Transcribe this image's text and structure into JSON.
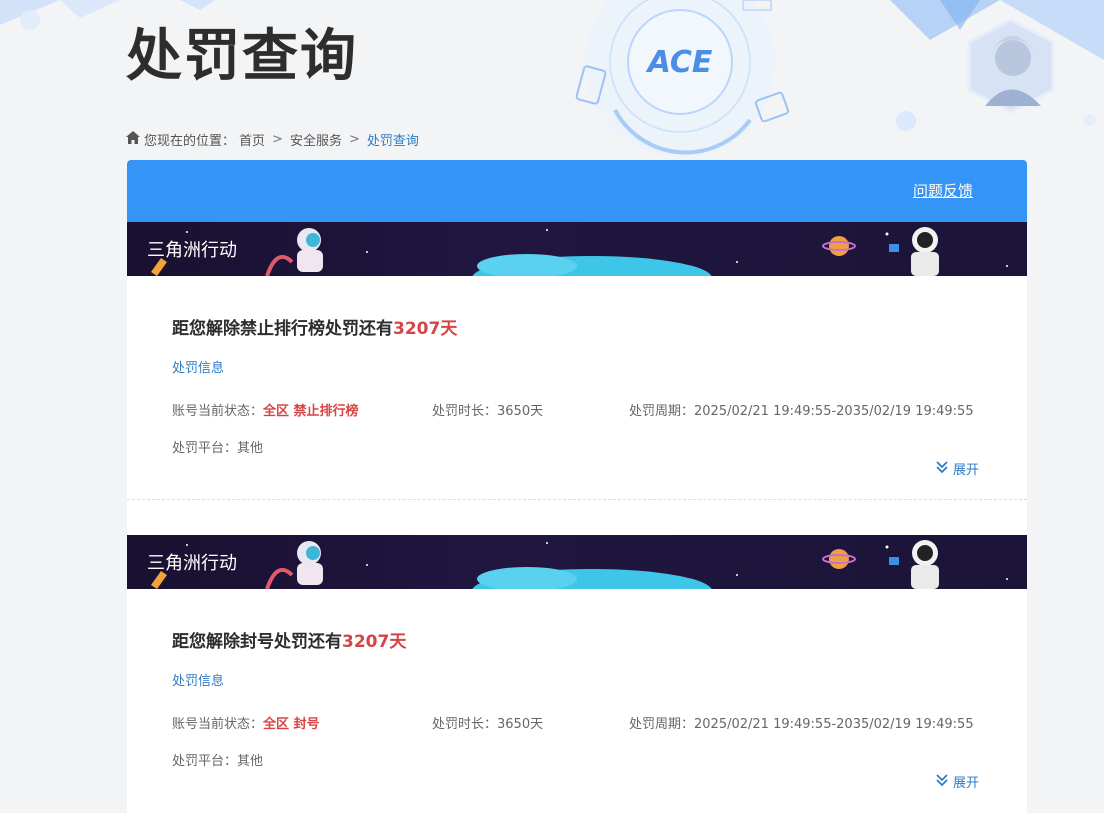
{
  "page": {
    "title": "处罚查询"
  },
  "breadcrumb": {
    "prefix": "您现在的位置：",
    "items": [
      "首页",
      "安全服务",
      "处罚查询"
    ],
    "separator": ">"
  },
  "header": {
    "feedback_label": "问题反馈",
    "bar_color": "#3595f6",
    "logo_text": "ACE"
  },
  "records": [
    {
      "game_name": "三角洲行动",
      "headline_prefix": "距您解除禁止排行榜处罚还有",
      "headline_days": "3207天",
      "section_label": "处罚信息",
      "status_label": "账号当前状态：",
      "status_value": "全区 禁止排行榜",
      "duration_label": "处罚时长：",
      "duration_value": "3650天",
      "period_label": "处罚周期：",
      "period_value": "2025/02/21 19:49:55-2035/02/19 19:49:55",
      "platform_label": "处罚平台：",
      "platform_value": "其他",
      "expand_label": "展开"
    },
    {
      "game_name": "三角洲行动",
      "headline_prefix": "距您解除封号处罚还有",
      "headline_days": "3207天",
      "section_label": "处罚信息",
      "status_label": "账号当前状态：",
      "status_value": "全区 封号",
      "duration_label": "处罚时长：",
      "duration_value": "3650天",
      "period_label": "处罚周期：",
      "period_value": "2025/02/21 19:49:55-2035/02/19 19:49:55",
      "platform_label": "处罚平台：",
      "platform_value": "其他",
      "expand_label": "展开"
    }
  ],
  "colors": {
    "accent_red": "#d64545",
    "link_blue": "#2e7bc6"
  }
}
